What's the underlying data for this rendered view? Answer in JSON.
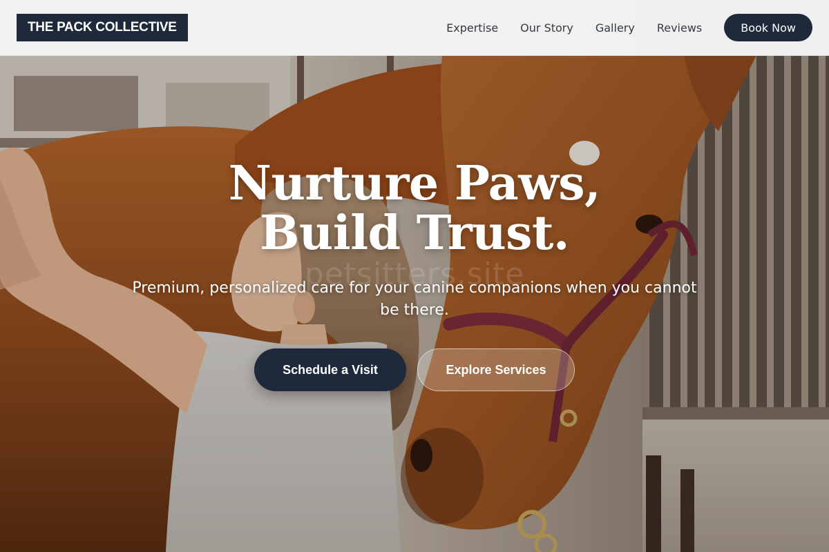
{
  "brand": {
    "name": "THE PACK COLLECTIVE"
  },
  "nav": {
    "items": [
      {
        "label": "Expertise"
      },
      {
        "label": "Our Story"
      },
      {
        "label": "Gallery"
      },
      {
        "label": "Reviews"
      }
    ],
    "cta_label": "Book Now"
  },
  "hero": {
    "title": "Nurture Paws, Build Trust.",
    "subtitle": "Premium, personalized care for your canine companions when you cannot be there.",
    "watermark": "petsitters.site",
    "primary_cta": "Schedule a Visit",
    "secondary_cta": "Explore Services",
    "background_image": "woman-grooming-chestnut-horse-in-stable"
  },
  "colors": {
    "navy": "#1e293b",
    "header_bg": "#f6f6f6",
    "nav_text": "#333a44",
    "white": "#ffffff"
  }
}
